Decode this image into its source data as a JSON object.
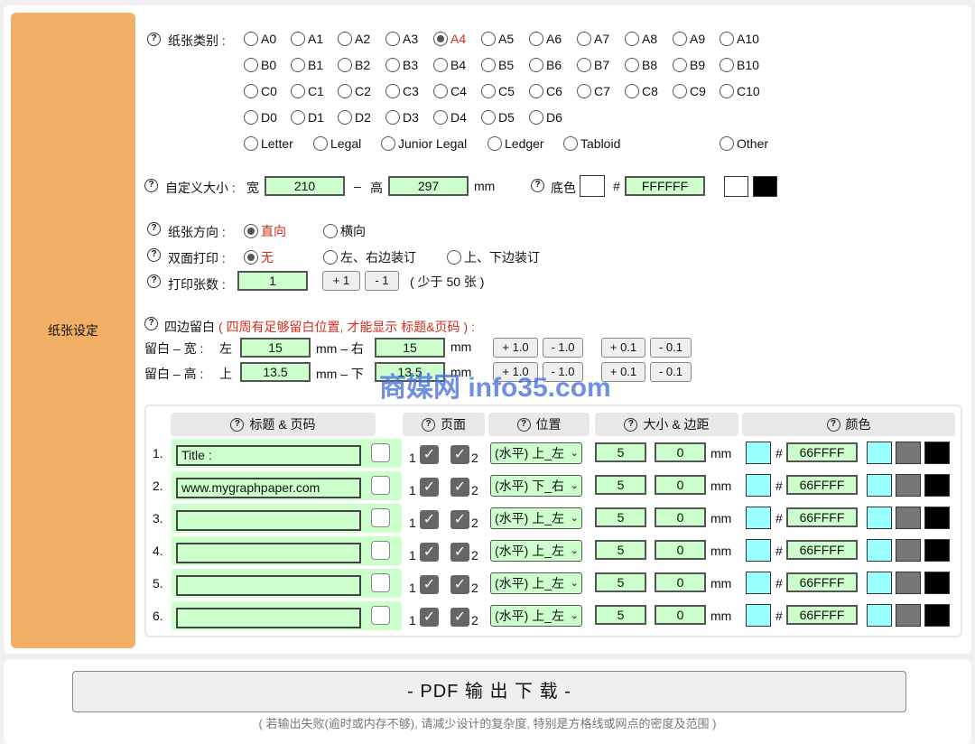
{
  "sidebar": {
    "label": "纸张设定"
  },
  "paper_type": {
    "label": "纸张类别 :",
    "selected": "A4",
    "rows": [
      [
        "A0",
        "A1",
        "A2",
        "A3",
        "A4",
        "A5",
        "A6",
        "A7",
        "A8",
        "A9",
        "A10"
      ],
      [
        "B0",
        "B1",
        "B2",
        "B3",
        "B4",
        "B5",
        "B6",
        "B7",
        "B8",
        "B9",
        "B10"
      ],
      [
        "C0",
        "C1",
        "C2",
        "C3",
        "C4",
        "C5",
        "C6",
        "C7",
        "C8",
        "C9",
        "C10"
      ],
      [
        "D0",
        "D1",
        "D2",
        "D3",
        "D4",
        "D5",
        "D6"
      ]
    ],
    "special": [
      "Letter",
      "Legal",
      "Junior Legal",
      "Ledger",
      "Tabloid"
    ],
    "other": "Other"
  },
  "custom_size": {
    "label": "自定义大小 :",
    "width_label": "宽",
    "width": "210",
    "dash": "–",
    "height_label": "高",
    "height": "297",
    "unit": "mm"
  },
  "background": {
    "label": "底色",
    "hash": "#",
    "value": "FFFFFF",
    "swatches": [
      "#ffffff",
      "#000000"
    ]
  },
  "orientation": {
    "label": "纸张方向 :",
    "options": [
      "直向",
      "横向"
    ],
    "selected": "直向"
  },
  "duplex": {
    "label": "双面打印 :",
    "options": [
      "无",
      "左、右边装订",
      "上、下边装订"
    ],
    "selected": "无"
  },
  "copies": {
    "label": "打印张数 :",
    "value": "1",
    "plus": "+ 1",
    "minus": "- 1",
    "note": "( 少于 50 张 )"
  },
  "margins": {
    "label": "四边留白",
    "note": "( 四周有足够留白位置, 才能显示 标题&页码 ) :",
    "width_row": {
      "label": "留白 – 宽 :",
      "left_label": "左",
      "left": "15",
      "mid": "mm – 右",
      "right": "15",
      "unit": "mm"
    },
    "height_row": {
      "label": "留白 – 高 :",
      "top_label": "上",
      "top": "13.5",
      "mid": "mm – 下",
      "bottom": "13.5",
      "unit": "mm"
    },
    "buttons": [
      "+ 1.0",
      "- 1.0",
      "+ 0.1",
      "- 0.1"
    ]
  },
  "header_table": {
    "columns": [
      "标题 & 页码",
      "页面",
      "位置",
      "大小 & 边距",
      "颜色"
    ],
    "rows": [
      {
        "num": "1.",
        "text": "Title :",
        "p1": "1",
        "p2": "2",
        "pos": "(水平) 上_左",
        "size": "5",
        "margin": "0",
        "unit": "mm",
        "hash": "#",
        "color": "66FFFF"
      },
      {
        "num": "2.",
        "text": "www.mygraphpaper.com",
        "p1": "1",
        "p2": "2",
        "pos": "(水平) 下_右",
        "size": "5",
        "margin": "0",
        "unit": "mm",
        "hash": "#",
        "color": "66FFFF"
      },
      {
        "num": "3.",
        "text": "",
        "p1": "1",
        "p2": "2",
        "pos": "(水平) 上_左",
        "size": "5",
        "margin": "0",
        "unit": "mm",
        "hash": "#",
        "color": "66FFFF"
      },
      {
        "num": "4.",
        "text": "",
        "p1": "1",
        "p2": "2",
        "pos": "(水平) 上_左",
        "size": "5",
        "margin": "0",
        "unit": "mm",
        "hash": "#",
        "color": "66FFFF"
      },
      {
        "num": "5.",
        "text": "",
        "p1": "1",
        "p2": "2",
        "pos": "(水平) 上_左",
        "size": "5",
        "margin": "0",
        "unit": "mm",
        "hash": "#",
        "color": "66FFFF"
      },
      {
        "num": "6.",
        "text": "",
        "p1": "1",
        "p2": "2",
        "pos": "(水平) 上_左",
        "size": "5",
        "margin": "0",
        "unit": "mm",
        "hash": "#",
        "color": "66FFFF"
      }
    ],
    "swatch_colors": [
      "#99ffff",
      "#777777",
      "#000000"
    ]
  },
  "download": {
    "label": "- PDF 输 出 下 载 -",
    "note": "( 若输出失败(逾时或内存不够), 请减少设计的复杂度, 特别是方格线或网点的密度及范围 )"
  },
  "watermark": "商媒网 info35.com"
}
